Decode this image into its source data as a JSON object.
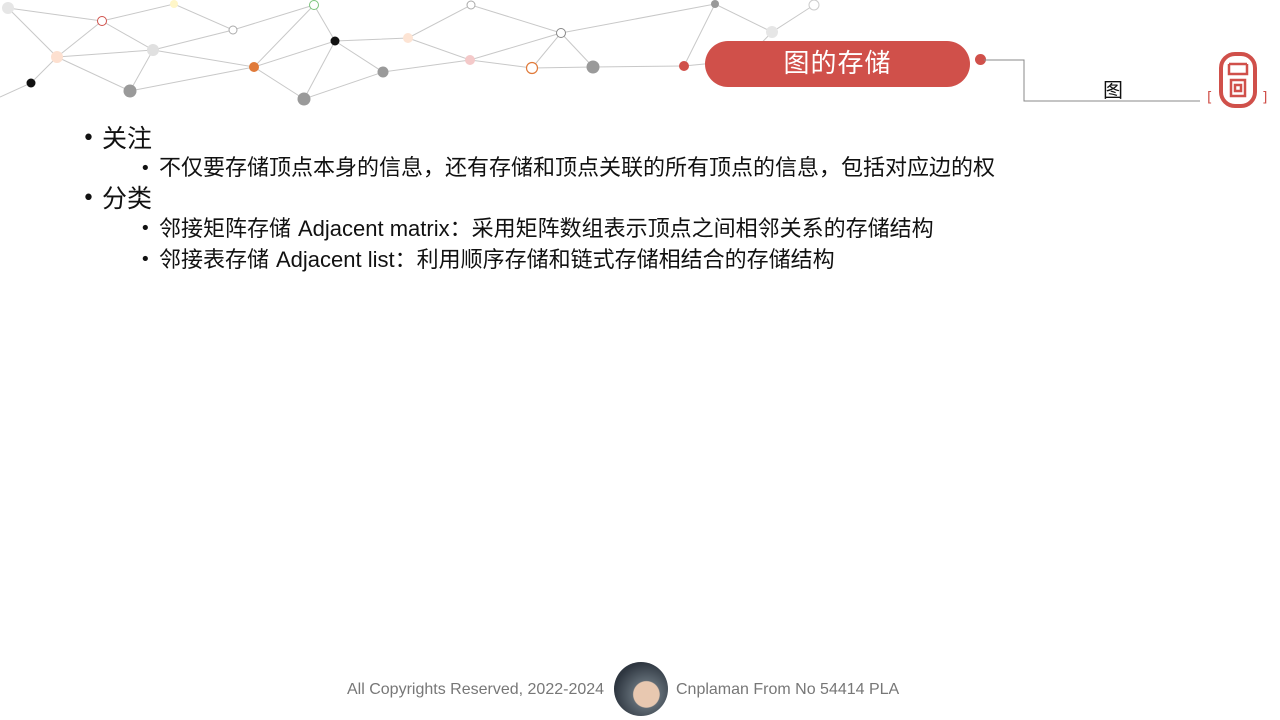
{
  "slide": {
    "title": "图的存储",
    "side_tag": "图"
  },
  "bullets": [
    {
      "text": "关注",
      "children": [
        {
          "text": "不仅要存储顶点本身的信息，还有存储和顶点关联的所有顶点的信息，包括对应边的权"
        }
      ]
    },
    {
      "text": "分类",
      "children": [
        {
          "pre": "邻接矩阵存储 ",
          "en": "Adjacent matrix",
          "post": "：采用矩阵数组表示顶点之间相邻关系的存储结构"
        },
        {
          "pre": "邻接表存储 ",
          "en": "Adjacent list",
          "post": "：利用顺序存储和链式存储相结合的存储结构"
        }
      ]
    }
  ],
  "footer": {
    "copyright": "All Copyrights Reserved, 2022-2024",
    "author": "Cnplaman From No 54414 PLA"
  },
  "colors": {
    "accent": "#d0504a",
    "footer_text": "#777777",
    "network_line": "#c8c8c8"
  },
  "icons": {
    "seal": "seal-stamp-icon",
    "avatar": "author-avatar"
  }
}
